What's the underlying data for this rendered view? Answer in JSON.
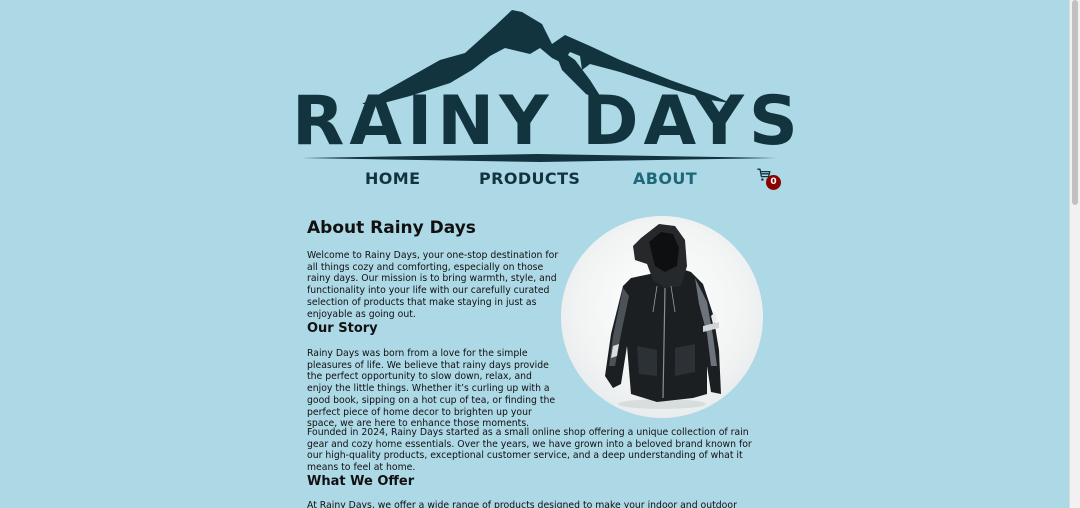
{
  "logo": {
    "text": "RAINY DAYS",
    "colors": {
      "primary": "#12343f"
    }
  },
  "nav": {
    "home": "HOME",
    "products": "PRODUCTS",
    "about": "ABOUT",
    "active": "ABOUT"
  },
  "cart": {
    "icon": "cart-icon",
    "count": "0",
    "badge_color": "#8b0000"
  },
  "content": {
    "title": "About Rainy Days",
    "welcome": "Welcome to Rainy Days, your one-stop destination for all things cozy and comforting, especially on those rainy days. Our mission is to bring warmth, style, and functionality into your life with our carefully curated selection of products that make staying in just as enjoyable as going out.",
    "story_heading": "Our Story",
    "story": "Rainy Days was born from a love for the simple pleasures of life. We believe that rainy days provide the perfect opportunity to slow down, relax, and enjoy the little things. Whether it’s curling up with a good book, sipping on a hot cup of tea, or finding the perfect piece of home decor to brighten up your space, we are here to enhance those moments.",
    "founded": "Founded in 2024, Rainy Days started as a small online shop offering a unique collection of rain gear and cozy home essentials. Over the years, we have grown into a beloved brand known for our high-quality products, exceptional customer service, and a deep understanding of what it means to feel at home.",
    "offer_heading": "What We Offer",
    "offer": "At Rainy Days, we offer a wide range of products designed to make your indoor and outdoor experiences more"
  },
  "colors": {
    "background": "#add8e6",
    "nav_active": "#1d6778"
  }
}
